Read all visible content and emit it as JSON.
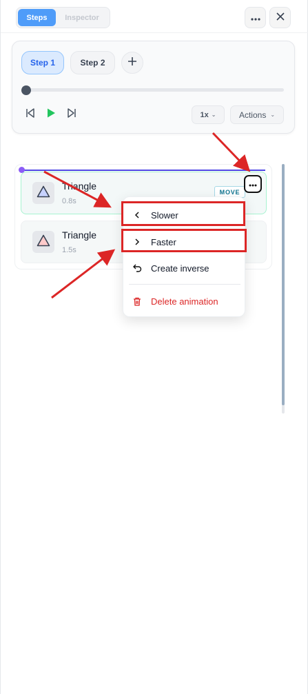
{
  "header": {
    "tabs": [
      {
        "label": "Steps",
        "active": true
      },
      {
        "label": "Inspector",
        "active": false
      }
    ],
    "more_icon": "ellipsis-icon",
    "close_icon": "close-icon"
  },
  "steps": {
    "items": [
      {
        "label": "Step 1",
        "active": true
      },
      {
        "label": "Step 2",
        "active": false
      }
    ],
    "add_icon": "plus-icon",
    "progress": 0,
    "controls": {
      "prev_icon": "skip-back-icon",
      "play_icon": "play-icon",
      "next_icon": "skip-forward-icon"
    },
    "speed_label": "1x",
    "actions_label": "Actions"
  },
  "animations": [
    {
      "name": "Triangle",
      "duration": "0.8s",
      "type": "MOVE",
      "selected": true,
      "shape_color": "#c7d2fe"
    },
    {
      "name": "Triangle",
      "duration": "1.5s",
      "type": "",
      "selected": false,
      "shape_color": "#fecaca"
    }
  ],
  "context_menu": {
    "items": [
      {
        "label": "Slower",
        "icon": "chevron-left-icon"
      },
      {
        "label": "Faster",
        "icon": "chevron-right-icon"
      },
      {
        "label": "Create inverse",
        "icon": "undo-icon"
      },
      {
        "label": "Delete animation",
        "icon": "trash-icon",
        "danger": true
      }
    ]
  },
  "colors": {
    "accent": "#4f9cf9",
    "play": "#22c55e",
    "annotation": "#dc2626",
    "danger": "#dc2626"
  }
}
